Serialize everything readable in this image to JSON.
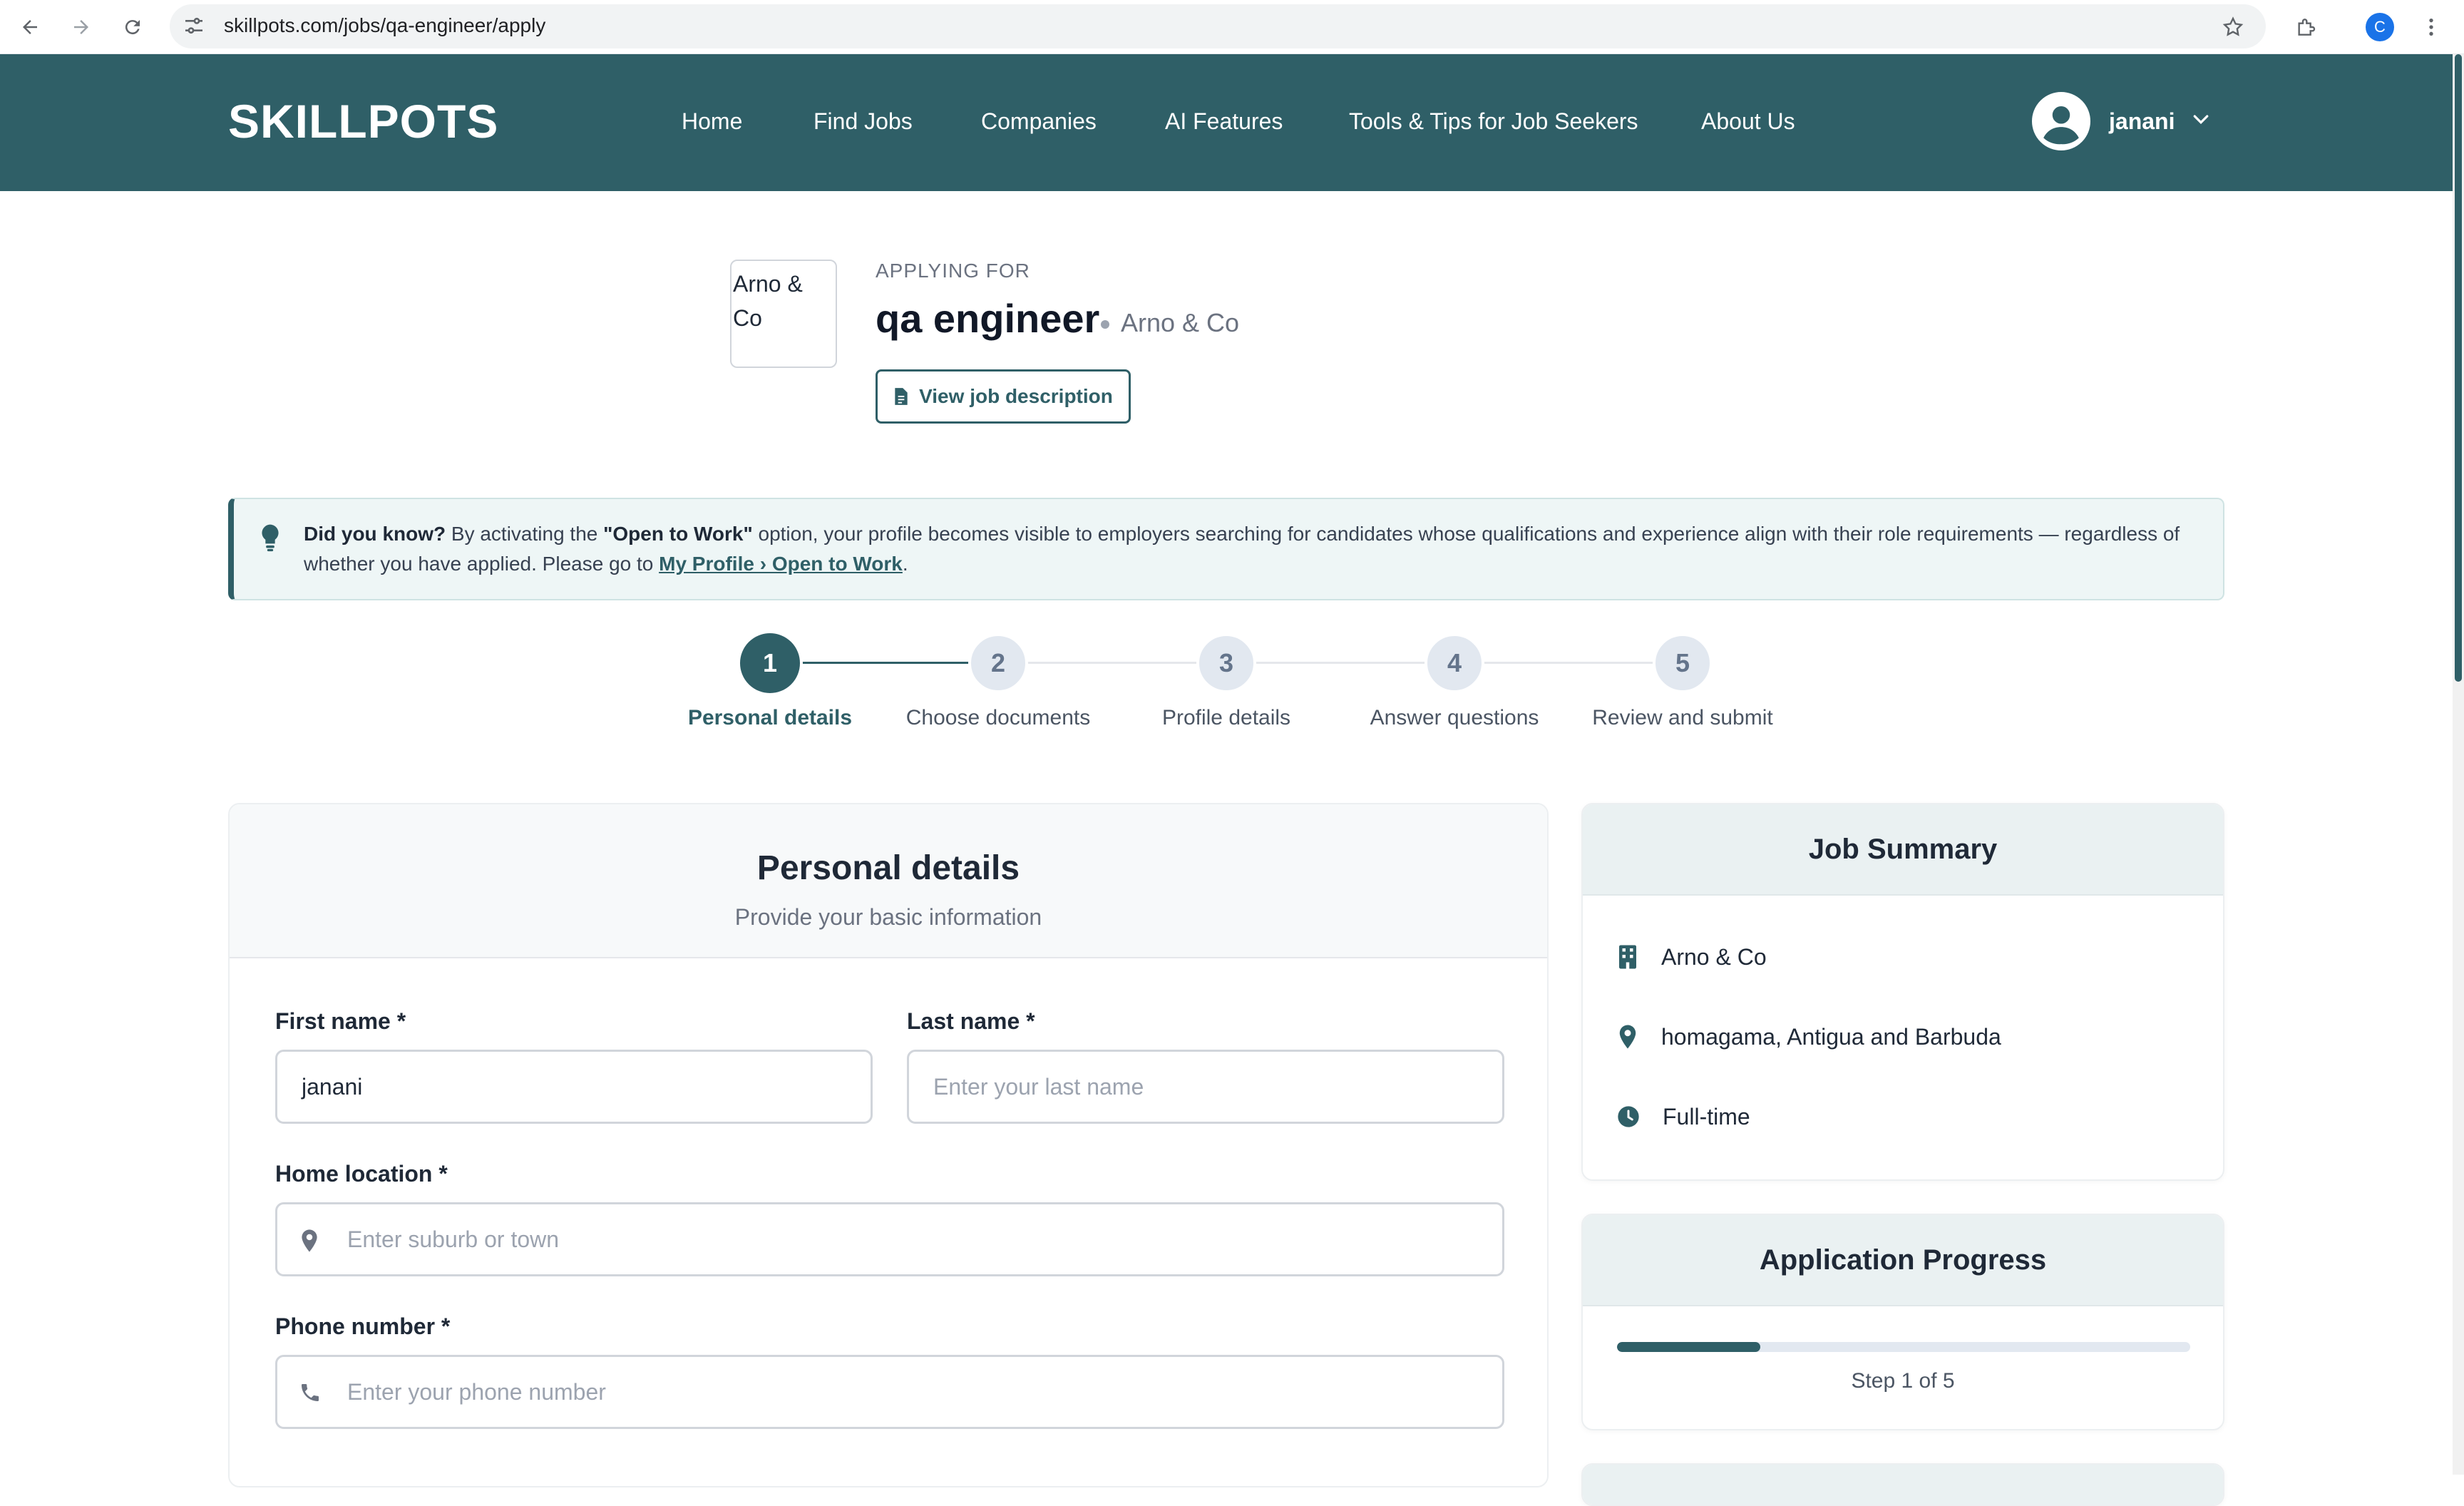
{
  "browser": {
    "url": "skillpots.com/jobs/qa-engineer/apply",
    "profile_initial": "C"
  },
  "header": {
    "logo": "SKILLPOTS",
    "nav": [
      "Home",
      "Find Jobs",
      "Companies",
      "AI Features",
      "Tools & Tips for Job Seekers",
      "About Us"
    ],
    "user_name": "janani"
  },
  "job": {
    "logo_alt": "Arno & Co",
    "applying_for": "APPLYING FOR",
    "title": "qa engineer",
    "company": "Arno & Co",
    "view_jd_label": "View job description"
  },
  "banner": {
    "lead": "Did you know?",
    "text1": "By activating the",
    "highlight": "\"Open to Work\"",
    "text2": "option, your profile becomes visible to employers searching for candidates whose qualifications and experience align with their role requirements — regardless of whether you have applied. Please go to",
    "link": "My Profile › Open to Work",
    "end": "."
  },
  "steps": [
    {
      "num": "1",
      "label": "Personal details"
    },
    {
      "num": "2",
      "label": "Choose documents"
    },
    {
      "num": "3",
      "label": "Profile details"
    },
    {
      "num": "4",
      "label": "Answer questions"
    },
    {
      "num": "5",
      "label": "Review and submit"
    }
  ],
  "form": {
    "title": "Personal details",
    "subtitle": "Provide your basic information",
    "first_name_label": "First name *",
    "first_name_value": "janani",
    "last_name_label": "Last name *",
    "last_name_placeholder": "Enter your last name",
    "location_label": "Home location *",
    "location_placeholder": "Enter suburb or town",
    "phone_label": "Phone number *",
    "phone_placeholder": "Enter your phone number"
  },
  "summary": {
    "title": "Job Summary",
    "company": "Arno & Co",
    "location": "homagama, Antigua and Barbuda",
    "type": "Full-time"
  },
  "progress": {
    "title": "Application Progress",
    "fraction": 0.25,
    "label": "Step 1 of 5"
  },
  "colors": {
    "brand": "#2f5f67",
    "banner_bg": "#eef6f6"
  }
}
